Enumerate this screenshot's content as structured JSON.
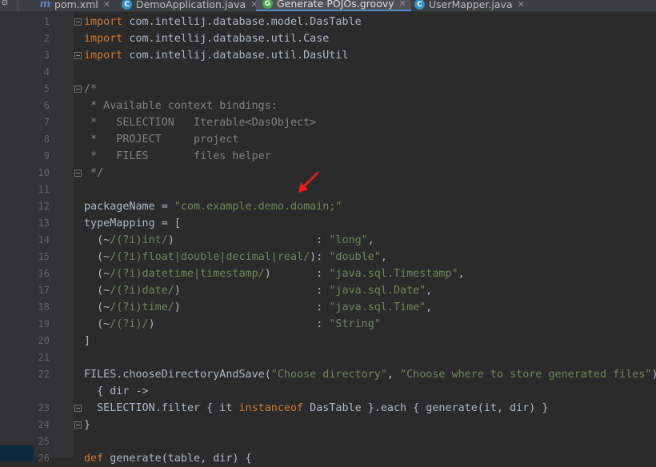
{
  "tabs": [
    {
      "icon_letter": "m",
      "label": "pom.xml",
      "icon_color": "#5a7fc4",
      "icon_name": "maven-icon"
    },
    {
      "icon_letter": "C",
      "label": "DemoApplication.java",
      "icon_color": "#3592c4",
      "icon_name": "spring-class-icon"
    },
    {
      "icon_letter": "G",
      "label": "Generate POJOs.groovy",
      "icon_color": "#4aa54a",
      "icon_name": "groovy-icon"
    },
    {
      "icon_letter": "C",
      "label": "UserMapper.java",
      "icon_color": "#3592c4",
      "icon_name": "class-icon"
    }
  ],
  "active_tab": 2,
  "editor": {
    "line_numbers": [
      "1",
      "2",
      "3",
      "4",
      "5",
      "6",
      "7",
      "8",
      "9",
      "10",
      "11",
      "12",
      "13",
      "14",
      "15",
      "16",
      "17",
      "18",
      "19",
      "20",
      "21",
      "22",
      "23",
      "24",
      "25",
      "26"
    ],
    "lines": {
      "l1": {
        "kw": "import",
        "rest": " com.intellij.database.model.DasTable"
      },
      "l2": {
        "kw": "import",
        "rest": " com.intellij.database.util.Case"
      },
      "l3": {
        "kw": "import",
        "rest": " com.intellij.database.util.DasUtil"
      },
      "l5": "/*",
      "l6": " * Available context bindings:",
      "l7": " *   SELECTION   Iterable<DasObject>",
      "l8": " *   PROJECT     project",
      "l9": " *   FILES       files helper",
      "l10": " */",
      "l12": {
        "a": "packageName = ",
        "s": "\"com.example.demo.domain;\""
      },
      "l13": "typeMapping = [",
      "l14": {
        "a": "  (~",
        "s": "/(?i)int/",
        "b": ")                      : ",
        "v": "\"long\"",
        "c": ","
      },
      "l15": {
        "a": "  (~",
        "s": "/(?i)float|double|decimal|real/",
        "b": "): ",
        "v": "\"double\"",
        "c": ","
      },
      "l16": {
        "a": "  (~",
        "s": "/(?i)datetime|timestamp/",
        "b": ")       : ",
        "v": "\"java.sql.Timestamp\"",
        "c": ","
      },
      "l17": {
        "a": "  (~",
        "s": "/(?i)date/",
        "b": ")                     : ",
        "v": "\"java.sql.Date\"",
        "c": ","
      },
      "l18": {
        "a": "  (~",
        "s": "/(?i)time/",
        "b": ")                     : ",
        "v": "\"java.sql.Time\"",
        "c": ","
      },
      "l19": {
        "a": "  (~",
        "s": "/(?i)/",
        "b": ")                         : ",
        "v": "\"String\"",
        "c": ""
      },
      "l20": "]",
      "l22": {
        "a": "FILES.chooseDirectoryAndSave(",
        "s1": "\"Choose directory\"",
        "b": ", ",
        "s2": "\"Choose where to store generated files\"",
        "c": ")"
      },
      "l22b": "  { dir ->",
      "l23": {
        "a": "  SELECTION.filter { it ",
        "kw": "instanceof",
        "b": " DasTable }.each { generate(it, dir) }"
      },
      "l24": "}",
      "l26": {
        "kw": "def",
        "rest": " generate(table, dir) {"
      }
    }
  },
  "colors": {
    "keyword": "#cc7832",
    "string": "#6a8759",
    "comment": "#808080",
    "text": "#a9b7c6",
    "arrow": "#ee1c1c"
  },
  "annotation": {
    "icon_name": "red-arrow-icon"
  }
}
